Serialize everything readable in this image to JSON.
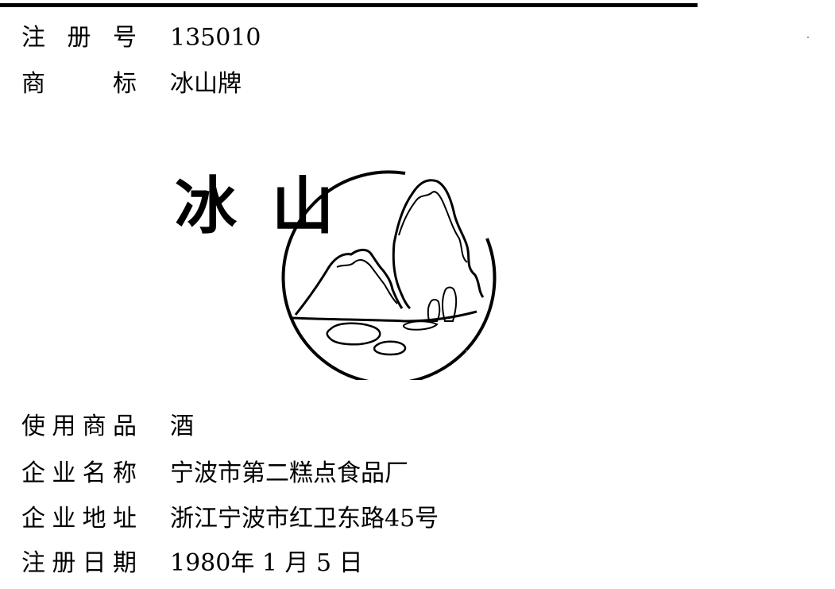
{
  "registration_number": {
    "label": "注册号",
    "value": "135010"
  },
  "trademark_name": {
    "label": "商标",
    "value": "冰山牌"
  },
  "logo": {
    "text_char_1": "冰",
    "text_char_2": "山"
  },
  "goods": {
    "label": "使用商品",
    "value": "酒"
  },
  "company_name": {
    "label": "企业名称",
    "value": "宁波市第二糕点食品厂"
  },
  "company_address": {
    "label": "企业地址",
    "value": "浙江宁波市红卫东路45号"
  },
  "registration_date": {
    "label": "注册日期",
    "value": "1980年 1 月 5 日"
  }
}
